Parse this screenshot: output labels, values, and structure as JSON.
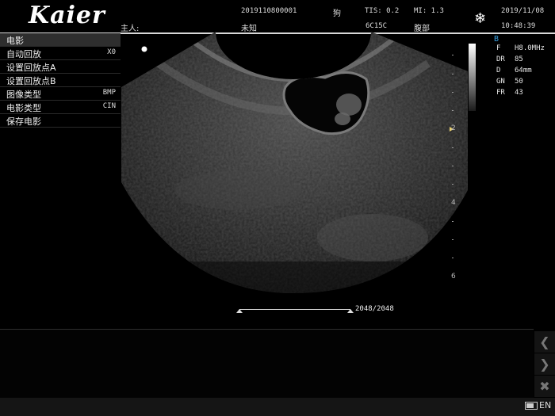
{
  "header": {
    "logo": "Kaier",
    "owner_label": "主人:",
    "owner_value": "未知",
    "patient_id": "2019110800001",
    "species": "狗",
    "tis": "TIS: 0.2",
    "mi": "MI: 1.3",
    "probe": "6C15C",
    "exam": "腹部",
    "date": "2019/11/08",
    "time": "10:48:39",
    "freeze_icon": "snowflake-icon"
  },
  "menu": {
    "title": "电影",
    "items": [
      {
        "label": "自动回放",
        "value": "X0"
      },
      {
        "label": "设置回放点A",
        "value": ""
      },
      {
        "label": "设置回放点B",
        "value": ""
      },
      {
        "label": "图像类型",
        "value": "BMP"
      },
      {
        "label": "电影类型",
        "value": "CIN"
      },
      {
        "label": "保存电影",
        "value": ""
      }
    ]
  },
  "params": {
    "mode": "B",
    "rows": [
      {
        "key": "F",
        "value": "H8.0MHz"
      },
      {
        "key": "DR",
        "value": "85"
      },
      {
        "key": "D",
        "value": "64mm"
      },
      {
        "key": "GN",
        "value": "50"
      },
      {
        "key": "FR",
        "value": "43"
      }
    ]
  },
  "depth_scale": {
    "labels": [
      "2",
      "4",
      "6"
    ]
  },
  "cine": {
    "frames": "2048/2048"
  },
  "side_buttons": [
    "chevron-left-icon",
    "chevron-right-icon",
    "close-icon"
  ],
  "status": {
    "language": "EN"
  }
}
